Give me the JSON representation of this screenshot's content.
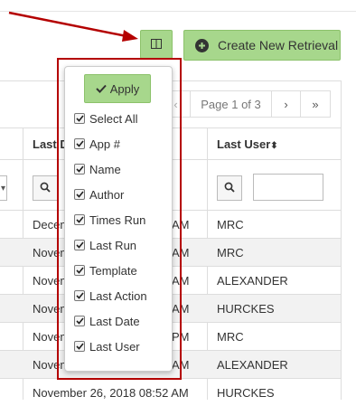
{
  "toolbar": {
    "create_label": "Create New Retrieval",
    "columns_icon": "columns-icon",
    "create_icon": "plus-circle-icon"
  },
  "pager": {
    "first": "«",
    "prev": "‹",
    "page_text": "Page 1 of 3",
    "next": "›",
    "last": "»"
  },
  "table": {
    "headers": {
      "last_date": "Last D",
      "last_user": "Last User"
    },
    "sort_icon": "sort-icon",
    "search_icon": "search-icon",
    "rows": [
      {
        "date_left": "Decem",
        "date_right": "AM",
        "user": "MRC"
      },
      {
        "date_left": "Novem",
        "date_right": "AM",
        "user": "MRC"
      },
      {
        "date_left": "Novem",
        "date_right": "AM",
        "user": "ALEXANDER"
      },
      {
        "date_left": "Novem",
        "date_right": "AM",
        "user": "HURCKES"
      },
      {
        "date_left": "Novem",
        "date_right": "PM",
        "user": "MRC"
      },
      {
        "date_left": "Novem",
        "date_right": "AM",
        "user": "ALEXANDER"
      },
      {
        "date_full": "November 26, 2018 08:52 AM",
        "user": "HURCKES"
      }
    ]
  },
  "dropdown": {
    "apply_label": "Apply",
    "apply_icon": "checkmark-icon",
    "options": [
      {
        "label": "Select All",
        "checked": true
      },
      {
        "label": "App #",
        "checked": true
      },
      {
        "label": "Name",
        "checked": true
      },
      {
        "label": "Author",
        "checked": true
      },
      {
        "label": "Times Run",
        "checked": true
      },
      {
        "label": "Last Run",
        "checked": true
      },
      {
        "label": "Template",
        "checked": true
      },
      {
        "label": "Last Action",
        "checked": true
      },
      {
        "label": "Last Date",
        "checked": true
      },
      {
        "label": "Last User",
        "checked": true
      }
    ]
  },
  "colors": {
    "accent_green": "#a7d78c",
    "highlight_red": "#b40000"
  }
}
